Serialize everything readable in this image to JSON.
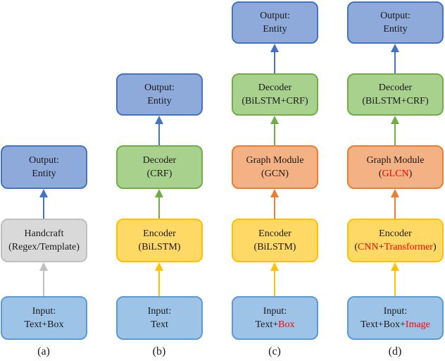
{
  "colors": {
    "output": "#8eaadb",
    "output_border": "#4472c4",
    "decoder": "#a9d18e",
    "decoder_border": "#70ad47",
    "encoder": "#ffd966",
    "encoder_border": "#ffc000",
    "graph_module": "#f4b183",
    "graph_module_border": "#ed7d31",
    "input": "#9dc3e6",
    "input_border": "#5b9bd5",
    "handcraft": "#d9d9d9",
    "handcraft_border": "#bfbfbf",
    "highlight": "#ff0000"
  },
  "panels": {
    "a": {
      "caption": "(a)",
      "output": {
        "line1": "Output:",
        "line2": "Entity"
      },
      "handcraft": {
        "line1": "Handcraft",
        "line2": "(Regex/Template)"
      },
      "input": {
        "line1": "Input:",
        "line2": "Text+Box"
      }
    },
    "b": {
      "caption": "(b)",
      "output": {
        "line1": "Output:",
        "line2": "Entity"
      },
      "decoder": {
        "line1": "Decoder",
        "line2": "(CRF)"
      },
      "encoder": {
        "line1": "Encoder",
        "line2": "(BiLSTM)"
      },
      "input": {
        "line1": "Input:",
        "line2": "Text"
      }
    },
    "c": {
      "caption": "(c)",
      "output": {
        "line1": "Output:",
        "line2": "Entity"
      },
      "decoder": {
        "line1": "Decoder",
        "line2": "(BiLSTM+CRF)"
      },
      "graph_module": {
        "line1": "Graph Module",
        "line2": "(GCN)"
      },
      "encoder": {
        "line1": "Encoder",
        "line2": "(BiLSTM)"
      },
      "input": {
        "line1": "Input:",
        "line2_prefix": "Text+",
        "line2_highlight": "Box"
      }
    },
    "d": {
      "caption": "(d)",
      "output": {
        "line1": "Output:",
        "line2": "Entity"
      },
      "decoder": {
        "line1": "Decoder",
        "line2": "(BiLSTM+CRF)"
      },
      "graph_module": {
        "line1": "Graph Module",
        "line2_open": "(",
        "line2_highlight": "GLCN",
        "line2_close": ")"
      },
      "encoder": {
        "line1": "Encoder",
        "line2_open": "(",
        "line2_hl1": "CNN",
        "line2_plus": "+",
        "line2_hl2": "Transformer",
        "line2_close": ")"
      },
      "input": {
        "line1": "Input:",
        "line2_prefix": "Text+Box+",
        "line2_highlight": "Image"
      }
    }
  }
}
